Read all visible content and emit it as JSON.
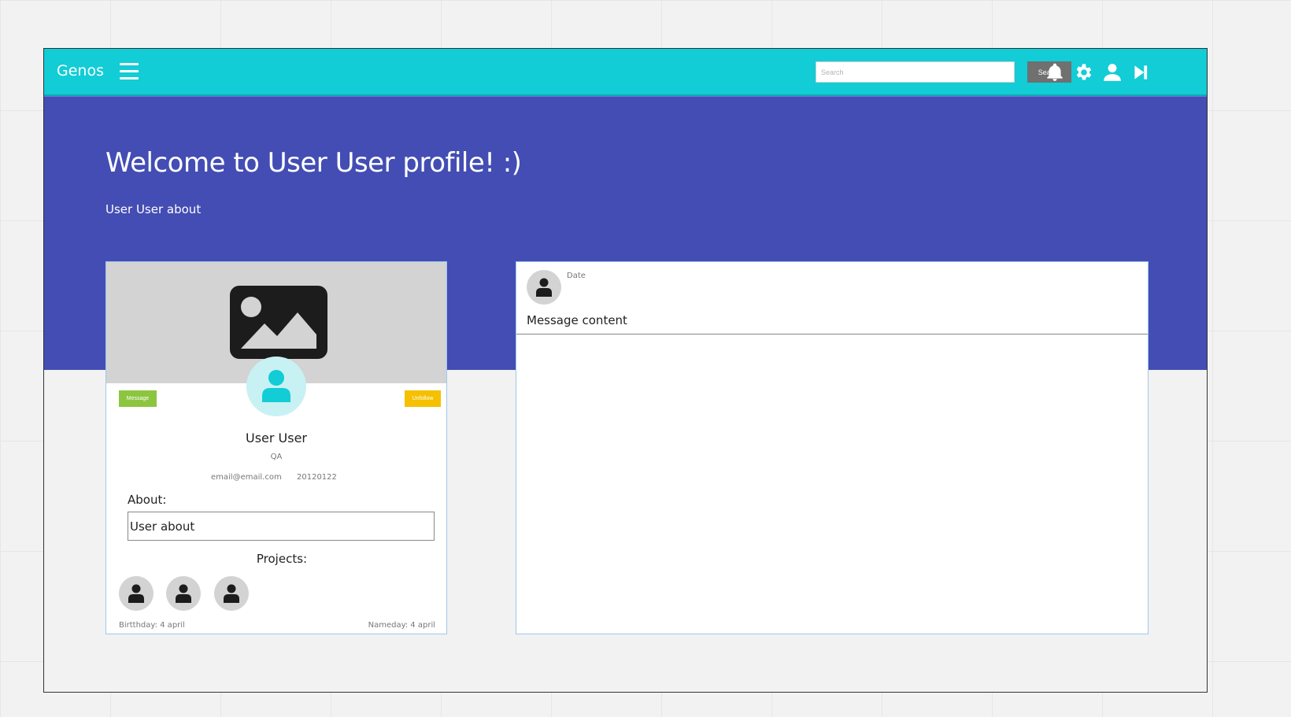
{
  "navbar": {
    "brand": "Genos",
    "menu_icon": "hamburger-menu-icon",
    "search": {
      "placeholder": "Search",
      "value": "",
      "button_label": "Search"
    },
    "icons": [
      "bell-icon",
      "gear-icon",
      "user-icon",
      "skip-forward-icon"
    ],
    "colors": {
      "background": "#12ccd6",
      "search_button": "#707070"
    }
  },
  "hero": {
    "title": "Welcome to User User profile! :)",
    "subtitle": "User User about",
    "background": "#434db3"
  },
  "profile": {
    "cover_icon": "image-placeholder-icon",
    "avatar_icon": "user-icon",
    "message_button": "Message",
    "unfollow_button": "Unfollow",
    "name": "User User",
    "role": "QA",
    "email": "email@email.com",
    "id": "20120122",
    "about_label": "About:",
    "about_value": "User about",
    "projects_label": "Projects:",
    "projects": [
      {
        "icon": "user-icon"
      },
      {
        "icon": "user-icon"
      },
      {
        "icon": "user-icon"
      }
    ],
    "birthday": "Birtthday: 4 april",
    "nameday": "Nameday: 4 april",
    "colors": {
      "message_button": "#8cc63f",
      "unfollow_button": "#f5c000",
      "avatar_bg": "#c8f1f3"
    }
  },
  "message": {
    "avatar_icon": "user-icon",
    "date": "Date",
    "content": "Message content"
  }
}
